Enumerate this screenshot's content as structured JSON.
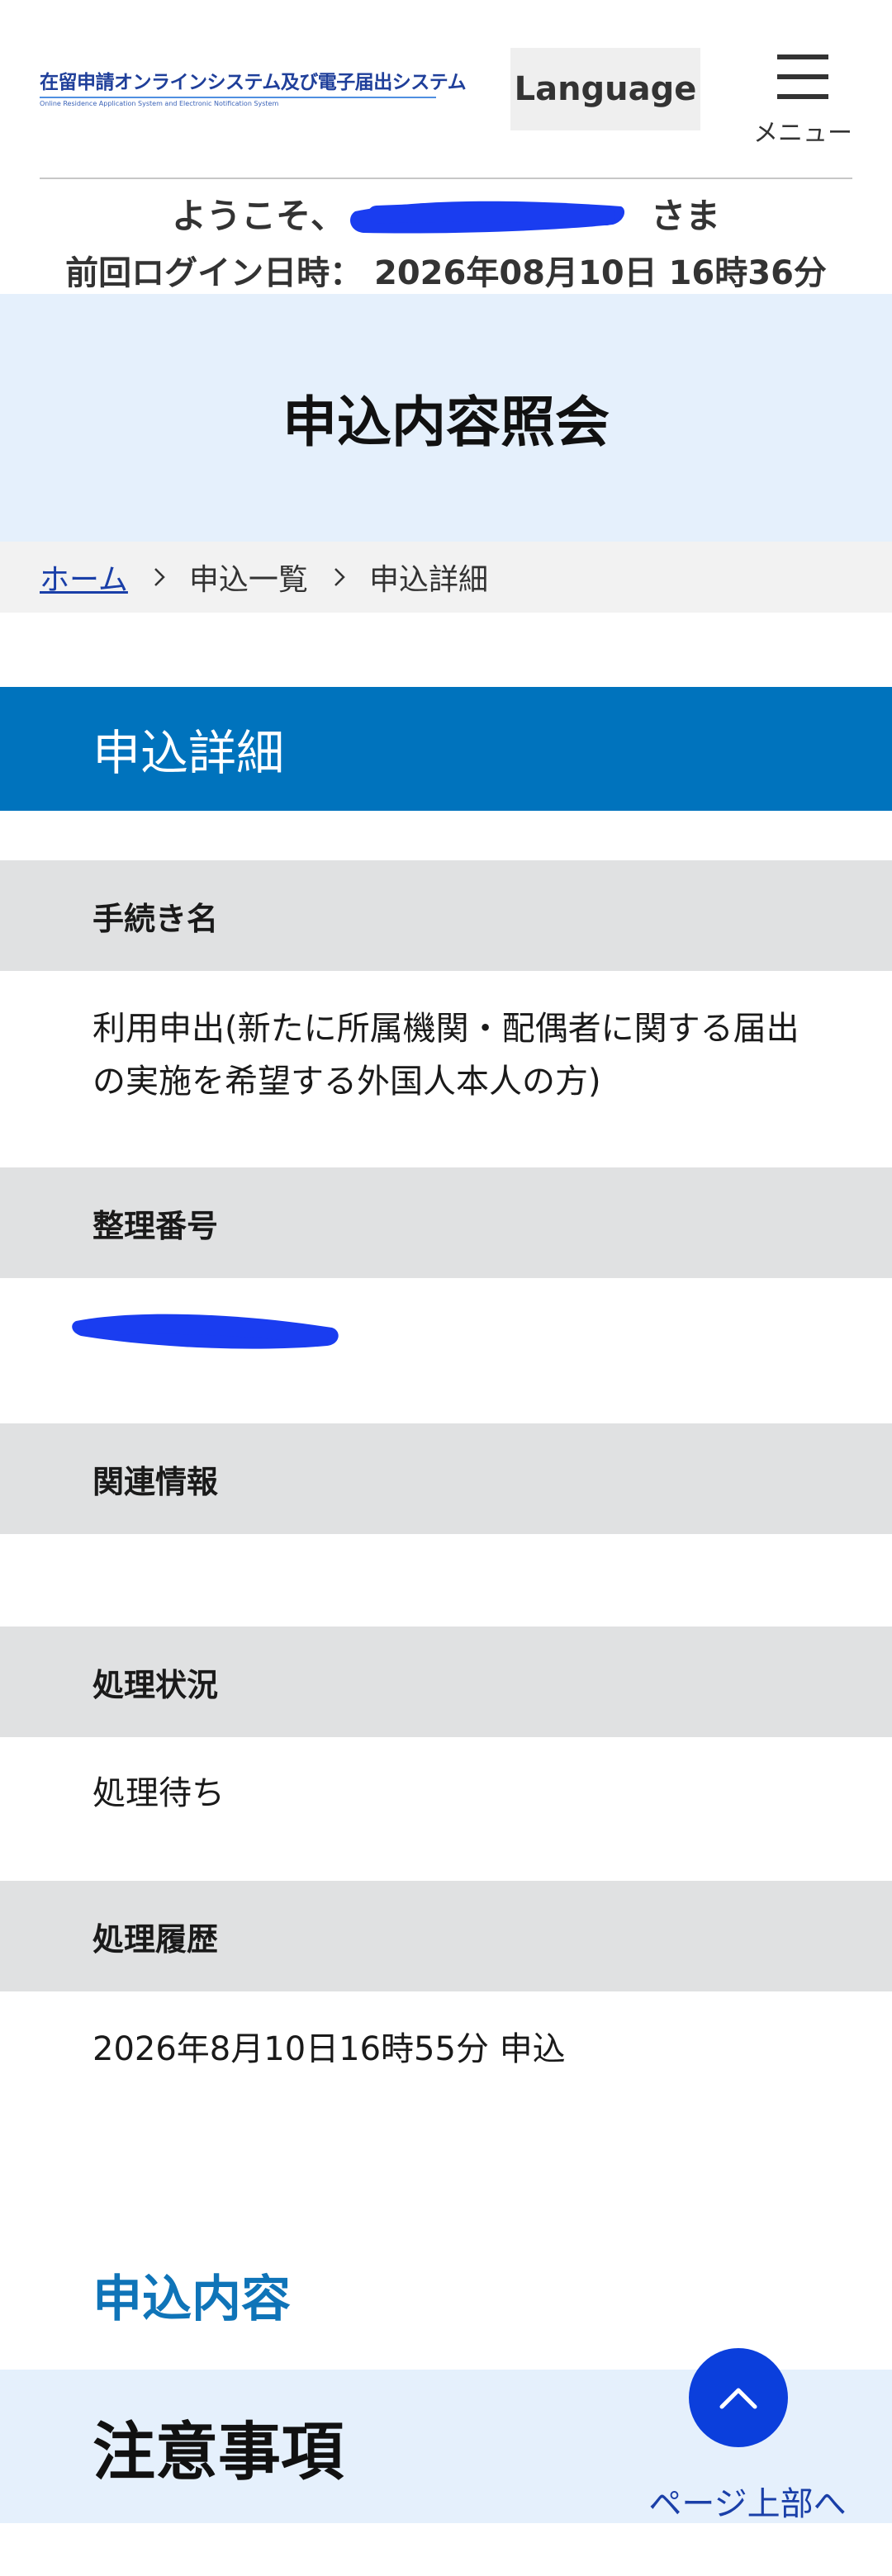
{
  "header": {
    "logo_text": "在留申請オンラインシステム及び電子届出システム",
    "logo_subtext": "Online Residence Application System and Electronic Notification System",
    "language_label": "Language",
    "menu_label": "メニュー"
  },
  "welcome": {
    "prefix": "ようこそ、",
    "suffix": "さま",
    "last_login": "前回ログイン日時： 2026年08月10日 16時36分"
  },
  "page": {
    "title": "申込内容照会"
  },
  "breadcrumb": {
    "home": "ホーム",
    "list": "申込一覧",
    "current": "申込詳細"
  },
  "section": {
    "title": "申込詳細"
  },
  "details": {
    "procedure_label": "手続き名",
    "procedure_value": "利用申出(新たに所属機関・配偶者に関する届出の実施を希望する外国人本人の方)",
    "ref_label": "整理番号",
    "related_label": "関連情報",
    "status_label": "処理状況",
    "status_value": "処理待ち",
    "history_label": "処理履歴",
    "history_value": "2026年8月10日16時55分 申込"
  },
  "bottom": {
    "application_heading": "申込内容",
    "notice_heading": "注意事項",
    "to_top_label": "ページ上部へ"
  },
  "colors": {
    "section_blue": "#0073bd",
    "redaction_blue": "#1a3df0",
    "to_top_blue": "#0b3fdc",
    "title_band": "#e5f0fc",
    "label_bar": "#e0e1e2"
  }
}
